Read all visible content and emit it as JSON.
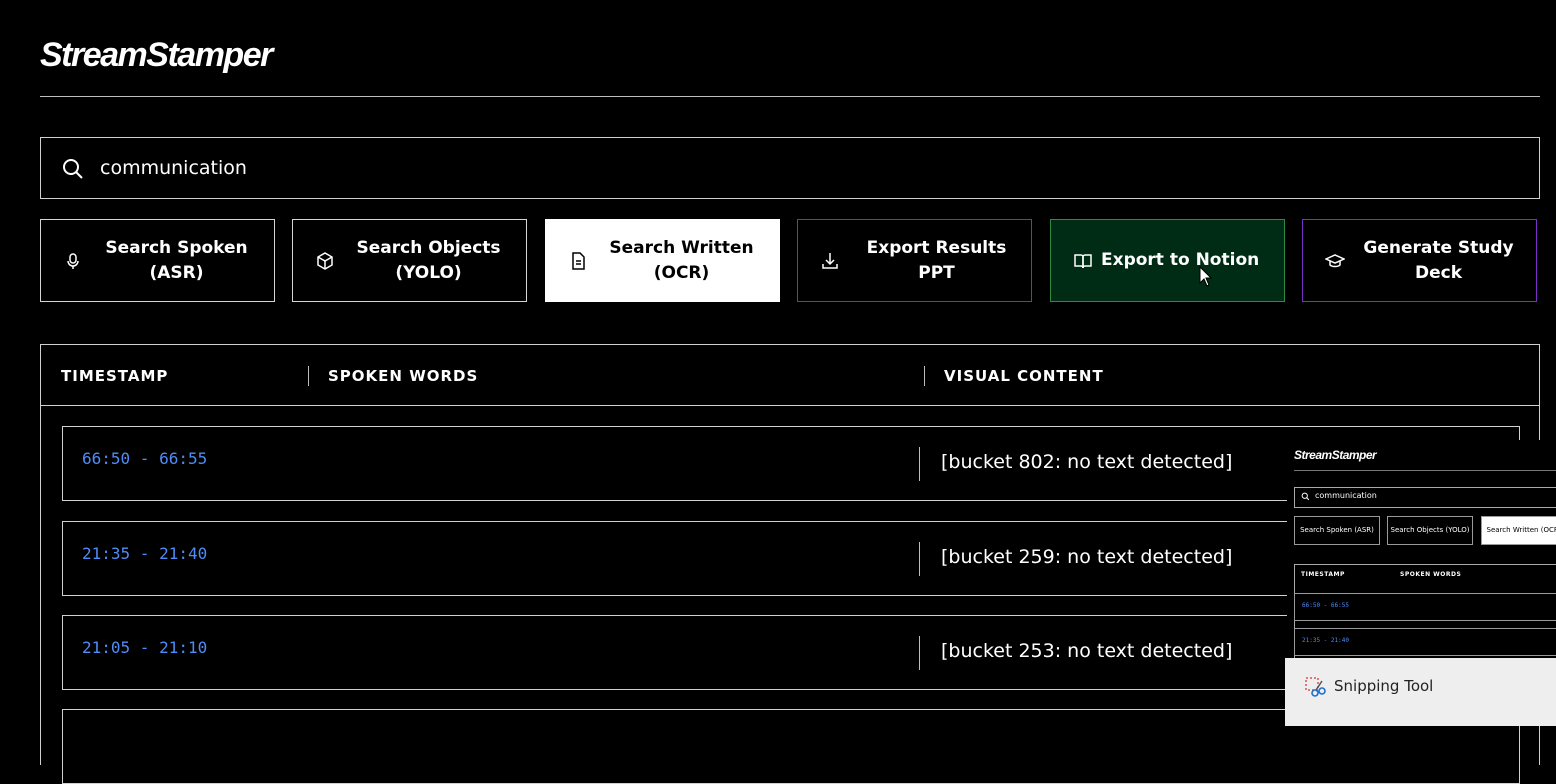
{
  "app": {
    "title": "StreamStamper"
  },
  "search": {
    "value": "communication"
  },
  "actions": {
    "search_spoken": [
      "Search Spoken",
      "(ASR)"
    ],
    "search_objects": [
      "Search Objects",
      "(YOLO)"
    ],
    "search_written": [
      "Search Written",
      "(OCR)"
    ],
    "export_ppt": "Export Results PPT",
    "export_notion": "Export to Notion",
    "study_deck": [
      "Generate Study",
      "Deck"
    ]
  },
  "table": {
    "headers": [
      "TIMESTAMP",
      "SPOKEN WORDS",
      "VISUAL CONTENT"
    ],
    "rows": [
      {
        "timestamp": "66:50 - 66:55",
        "spoken": "",
        "visual": "[bucket 802: no text detected]"
      },
      {
        "timestamp": "21:35 - 21:40",
        "spoken": "",
        "visual": "[bucket 259: no text detected]"
      },
      {
        "timestamp": "21:05 - 21:10",
        "spoken": "",
        "visual": "[bucket 253: no text detected]"
      }
    ]
  },
  "preview": {
    "title": "StreamStamper",
    "search": "communication",
    "buttons": [
      "Search Spoken (ASR)",
      "Search Objects (YOLO)",
      "Search Written (OCR)"
    ],
    "headers": [
      "TIMESTAMP",
      "SPOKEN WORDS"
    ],
    "rows": [
      "66:50 - 66:55",
      "21:35 - 21:40"
    ]
  },
  "taskbar": {
    "label": "Snipping Tool"
  },
  "colors": {
    "accent_timestamp": "#4f8cf7",
    "ppt_border": "#3b4ad4",
    "notion_bg": "#002b14",
    "notion_border": "#2f8a45",
    "deck_border": "#7b2fc9"
  },
  "icons": [
    "search-icon",
    "microphone-icon",
    "cube-icon",
    "document-icon",
    "download-icon",
    "book-open-icon",
    "graduation-cap-icon",
    "scissors-icon"
  ]
}
